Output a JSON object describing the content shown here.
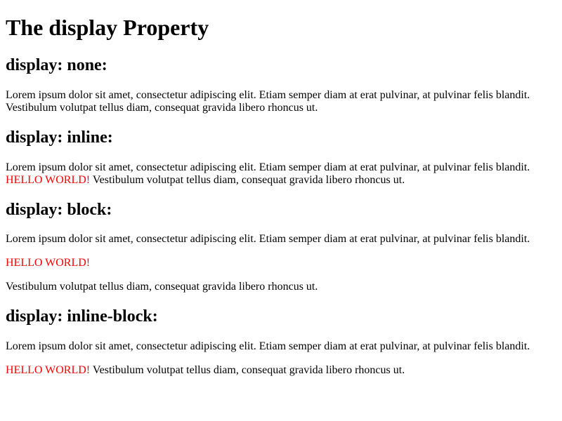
{
  "title": "The display Property",
  "accent_color": "#ff0000",
  "sections": [
    {
      "heading": "display: none:",
      "line1": "Lorem ipsum dolor sit amet, consectetur adipiscing elit. Etiam semper diam at erat pulvinar, at pulvinar felis blandit.",
      "line2": "Vestibulum volutpat tellus diam, consequat gravida libero rhoncus ut."
    },
    {
      "heading": "display: inline:",
      "line1": "Lorem ipsum dolor sit amet, consectetur adipiscing elit. Etiam semper diam at erat pulvinar, at pulvinar felis blandit.",
      "hello": "HELLO WORLD!",
      "line2": " Vestibulum volutpat tellus diam, consequat gravida libero rhoncus ut."
    },
    {
      "heading": "display: block:",
      "line1": "Lorem ipsum dolor sit amet, consectetur adipiscing elit. Etiam semper diam at erat pulvinar, at pulvinar felis blandit.",
      "hello": "HELLO WORLD!",
      "line2": "Vestibulum volutpat tellus diam, consequat gravida libero rhoncus ut."
    },
    {
      "heading": "display: inline-block:",
      "line1": "Lorem ipsum dolor sit amet, consectetur adipiscing elit. Etiam semper diam at erat pulvinar, at pulvinar felis blandit.",
      "hello": "HELLO WORLD!",
      "line2": " Vestibulum volutpat tellus diam, consequat gravida libero rhoncus ut."
    }
  ]
}
